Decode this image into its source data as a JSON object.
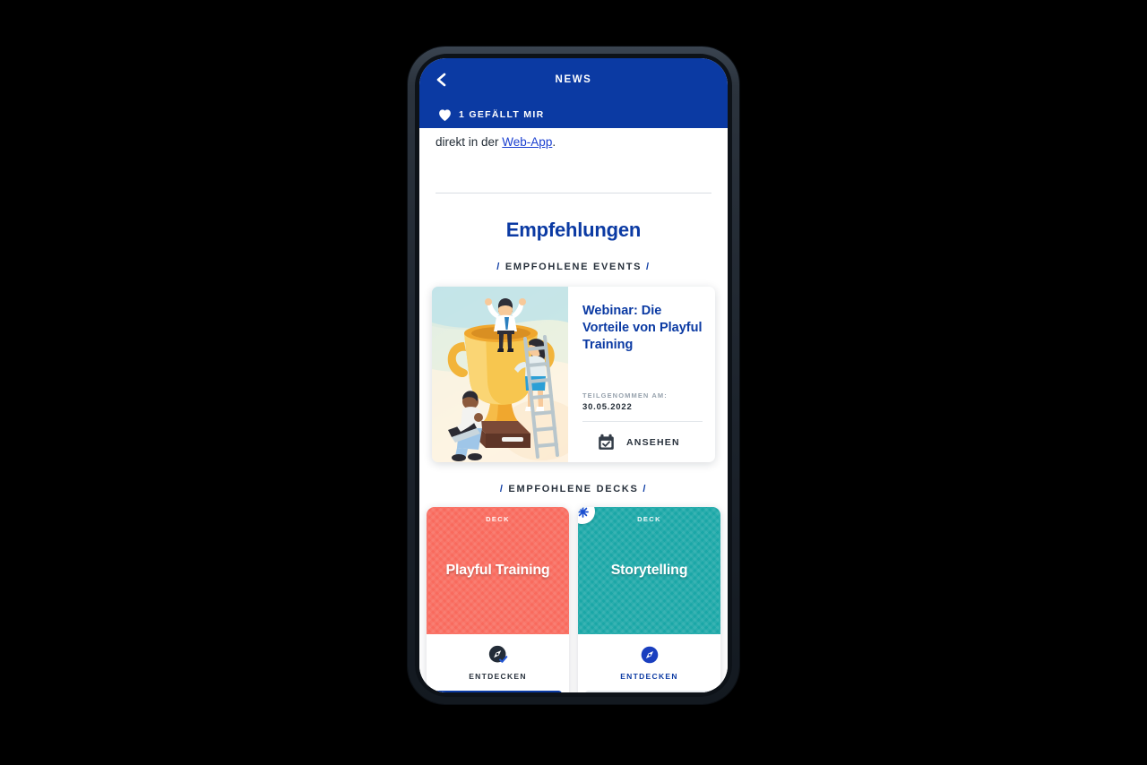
{
  "header": {
    "title": "NEWS",
    "back_icon": "chevron-left-icon",
    "like_icon": "heart-icon",
    "like_text": "1 GEFÄLLT MIR"
  },
  "article": {
    "tail_before_link": "direkt in der ",
    "link_text": "Web-App",
    "tail_after_link": "."
  },
  "recommendations": {
    "title": "Empfehlungen",
    "events_label": "EMPFOHLENE EVENTS",
    "decks_label": "EMPFOHLENE DECKS",
    "slash": "/"
  },
  "event_card": {
    "illustration_name": "trophy-celebration-illustration",
    "title": "Webinar: Die Vorteile von Playful Training",
    "meta_label": "TEILGENOMMEN AM:",
    "meta_value": "30.05.2022",
    "action_icon": "calendar-check-icon",
    "action_label": "ANSEHEN"
  },
  "decks": [
    {
      "kind": "DECK",
      "name": "Playful Training",
      "color": "#f96a5d",
      "badge": null,
      "action_icon": "compass-check-icon",
      "action_label": "ENTDECKEN",
      "action_color": "#28313c",
      "progress_percent": 100
    },
    {
      "kind": "DECK",
      "name": "Storytelling",
      "color": "#1aa7a7",
      "badge": "asterisk-badge-icon",
      "action_icon": "compass-icon",
      "action_label": "ENTDECKEN",
      "action_color": "#0b3aa3",
      "progress_percent": 0
    }
  ],
  "theme": {
    "brand_blue": "#0b3aa3",
    "link_blue": "#1a3fd0",
    "text_dark": "#1f2933",
    "muted": "#97a2ad",
    "deck_red": "#f96a5d",
    "deck_teal": "#1aa7a7",
    "frame_dark": "#1c232c"
  }
}
